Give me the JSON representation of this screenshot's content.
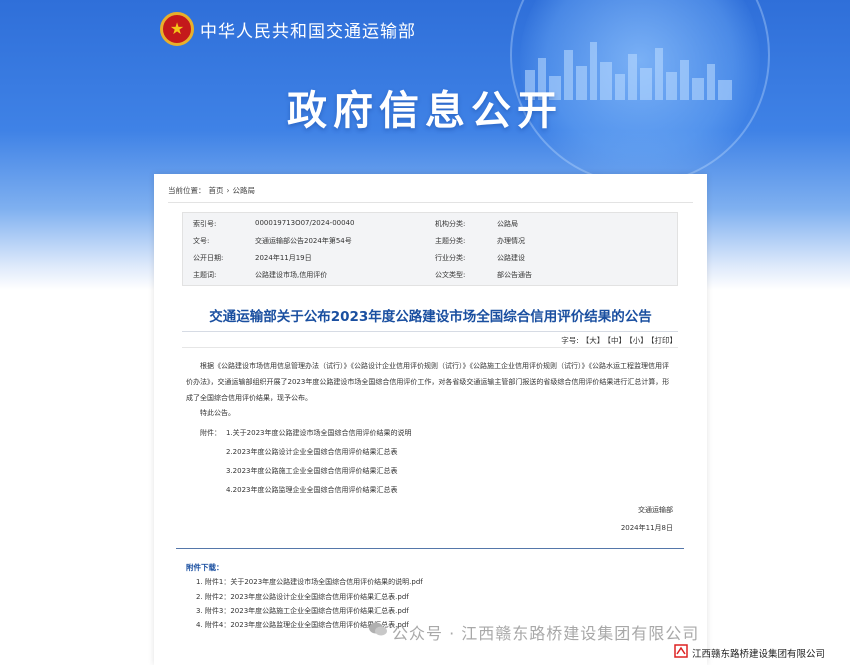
{
  "header": {
    "ministry_name": "中华人民共和国交通运输部",
    "page_title": "政府信息公开"
  },
  "breadcrumb": {
    "prefix": "当前位置：",
    "home": "首页",
    "separator": "›",
    "section": "公路局"
  },
  "meta": {
    "rows": [
      {
        "l1": "索引号:",
        "v1": "000019713O07/2024-00040",
        "l2": "机构分类:",
        "v2": "公路局"
      },
      {
        "l1": "文号:",
        "v1": "交通运输部公告2024年第54号",
        "l2": "主题分类:",
        "v2": "办理情况"
      },
      {
        "l1": "公开日期:",
        "v1": "2024年11月19日",
        "l2": "行业分类:",
        "v2": "公路建设"
      },
      {
        "l1": "主题词:",
        "v1": "公路建设市场,信用评价",
        "l2": "公文类型:",
        "v2": "部公告通告"
      }
    ]
  },
  "document": {
    "title": "交通运输部关于公布2023年度公路建设市场全国综合信用评价结果的公告",
    "font_size_label": "字号:",
    "font_large": "【大】",
    "font_medium": "【中】",
    "font_small": "【小】",
    "print": "【打印】",
    "paragraph": "根据《公路建设市场信用信息管理办法（试行）》《公路设计企业信用评价规则（试行）》《公路施工企业信用评价规则（试行）》《公路水运工程监理信用评价办法》，交通运输部组织开展了2023年度公路建设市场全国综合信用评价工作，对各省级交通运输主管部门报送的省级综合信用评价结果进行汇总计算，形成了全国综合信用评价结果，现予公布。",
    "notice": "特此公告。",
    "attach_prefix": "附件：",
    "attachments": [
      "1.关于2023年度公路建设市场全国综合信用评价结果的说明",
      "2.2023年度公路设计企业全国综合信用评价结果汇总表",
      "3.2023年度公路施工企业全国综合信用评价结果汇总表",
      "4.2023年度公路监理企业全国综合信用评价结果汇总表"
    ],
    "signature": "交通运输部",
    "date": "2024年11月8日"
  },
  "downloads": {
    "title": "附件下载：",
    "items": [
      "1. 附件1：关于2023年度公路建设市场全国综合信用评价结果的说明.pdf",
      "2. 附件2：2023年度公路设计企业全国综合信用评价结果汇总表.pdf",
      "3. 附件3：2023年度公路施工企业全国综合信用评价结果汇总表.pdf",
      "4. 附件4：2023年度公路监理企业全国综合信用评价结果汇总表.pdf"
    ]
  },
  "watermark": {
    "text": "公众号 · 江西赣东路桥建设集团有限公司"
  },
  "footer": {
    "company": "江西赣东路桥建设集团有限公司"
  },
  "colors": {
    "banner_blue": "#3f82e6",
    "title_blue": "#1a4fa0",
    "emblem_red": "#c4191b"
  }
}
